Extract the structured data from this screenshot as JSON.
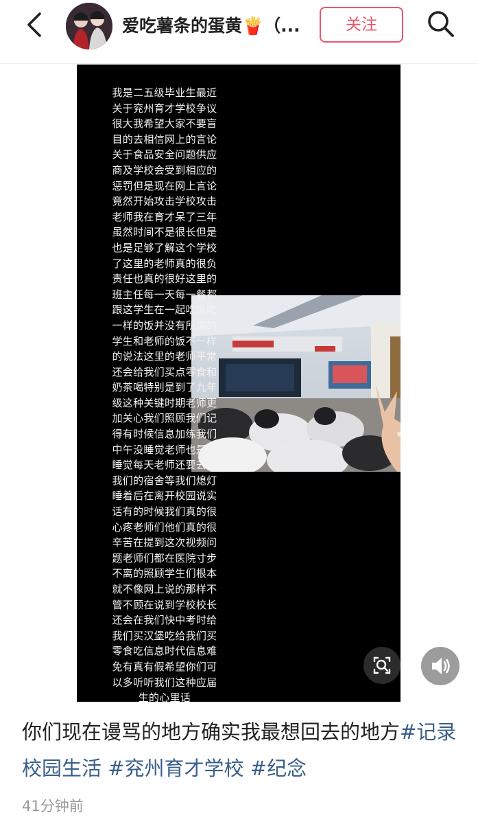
{
  "header": {
    "username": "爱吃薯条的蛋黄🍟（...",
    "follow_label": "关注"
  },
  "overlay_lines": [
    "我是二五级毕业生最近",
    "关于兖州育才学校争议",
    "很大我希望大家不要盲",
    "目的去相信网上的言论",
    "关于食品安全问题供应",
    "商及学校会受到相应的",
    "惩罚但是现在网上言论",
    "竟然开始攻击学校攻击",
    "老师我在育才呆了三年",
    "虽然时间不是很长但是",
    "也是足够了解这个学校",
    "了这里的老师真的很负",
    "责任也真的很好这里的",
    "班主任每一天每一餐都",
    "跟这学生在一起吃饭吃",
    "一样的饭并没有所谓的",
    "学生和老师的饭不一样",
    "的说法这里的老师平常",
    "还会给我们买点零食和",
    "奶茶喝特别是到了九年",
    "级这种关键时期老师更",
    "加关心我们照顾我们记",
    "得有时候信息加练我们",
    "中午没睡觉老师也是没",
    "睡觉每天老师还要去查",
    "我们的宿舍等我们熄灯",
    "睡着后在离开校园说实",
    "话有的时候我们真的很",
    "心疼老师们他们真的很",
    "辛苦在提到这次视频问",
    "题老师们都在医院寸步",
    "不离的照顾学生们根本",
    "就不像网上说的那样不",
    "管不顾在说到学校校长",
    "还会在我们快中考时给",
    "我们买汉堡吃给我们买",
    "零食吃信息时代信息难",
    "免有真有假希望你们可",
    "以多听听我们这种应届",
    "生的心里话"
  ],
  "post": {
    "text": "你们现在谩骂的地方确实我最想回去的地方",
    "tags": [
      "#记录校园生活",
      "#兖州育才学校",
      "#纪念"
    ],
    "time": "41分钟前"
  }
}
